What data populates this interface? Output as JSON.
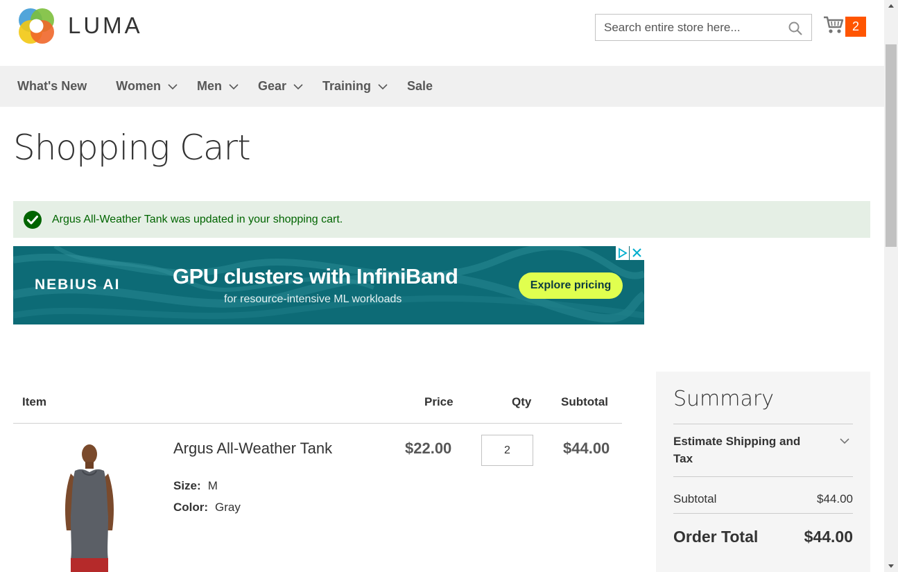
{
  "header": {
    "logo_text": "LUMA",
    "search_placeholder": "Search entire store here...",
    "cart_count": "2"
  },
  "nav": {
    "items": [
      {
        "label": "What's New",
        "has_submenu": false
      },
      {
        "label": "Women",
        "has_submenu": true
      },
      {
        "label": "Men",
        "has_submenu": true
      },
      {
        "label": "Gear",
        "has_submenu": true
      },
      {
        "label": "Training",
        "has_submenu": true
      },
      {
        "label": "Sale",
        "has_submenu": false
      }
    ]
  },
  "page": {
    "title": "Shopping Cart"
  },
  "message": {
    "text": "Argus All-Weather Tank was updated in your shopping cart.",
    "type": "success"
  },
  "ad": {
    "brand": "NEBIUS AI",
    "headline": "GPU clusters with InfiniBand",
    "subline": "for resource-intensive ML workloads",
    "cta": "Explore pricing"
  },
  "cart": {
    "headers": {
      "item": "Item",
      "price": "Price",
      "qty": "Qty",
      "subtotal": "Subtotal"
    },
    "items": [
      {
        "name": "Argus All-Weather Tank",
        "options": [
          {
            "label": "Size:",
            "value": "M"
          },
          {
            "label": "Color:",
            "value": "Gray"
          }
        ],
        "price": "$22.00",
        "qty": "2",
        "subtotal": "$44.00"
      }
    ]
  },
  "summary": {
    "title": "Summary",
    "estimate_label": "Estimate Shipping and Tax",
    "subtotal_label": "Subtotal",
    "subtotal_value": "$44.00",
    "order_total_label": "Order Total",
    "order_total_value": "$44.00"
  },
  "colors": {
    "accent": "#ff5501",
    "nav_bg": "#f0f0f0",
    "success_bg": "#e5efe5",
    "success_text": "#006400",
    "ad_bg": "#0d6b76",
    "ad_cta": "#e0ff4f"
  }
}
